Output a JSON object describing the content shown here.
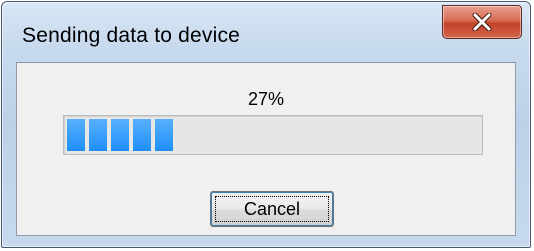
{
  "window": {
    "title": "Sending data to device",
    "close_icon": "close-x-icon"
  },
  "progress": {
    "percent_label": "27%",
    "value_percent": 27,
    "fill_color": "#1e8ef7",
    "blocks_filled": 5
  },
  "buttons": {
    "cancel_label": "Cancel"
  },
  "colors": {
    "close_button": "#c2432a",
    "client_background": "#f0f0f0"
  }
}
